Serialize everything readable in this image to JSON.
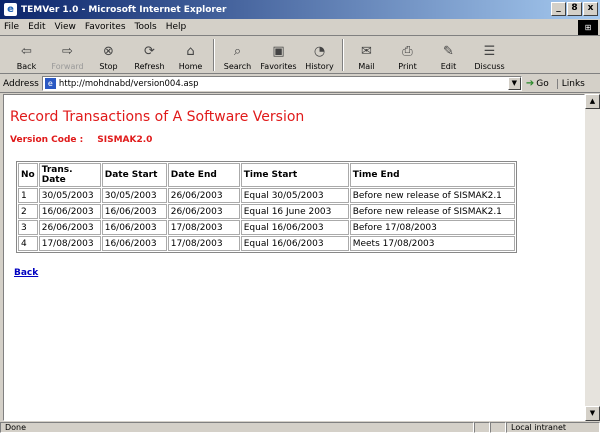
{
  "window": {
    "title": "TEMVer 1.0 - Microsoft Internet Explorer",
    "minimize": "_",
    "maximize": "8",
    "close": "x"
  },
  "menu": {
    "items": [
      "File",
      "Edit",
      "View",
      "Favorites",
      "Tools",
      "Help"
    ]
  },
  "toolbar": {
    "buttons": [
      {
        "label": "Back",
        "icon": "back-arrow-icon"
      },
      {
        "label": "Forward",
        "icon": "forward-arrow-icon"
      },
      {
        "label": "Stop",
        "icon": "stop-icon"
      },
      {
        "label": "Refresh",
        "icon": "refresh-icon"
      },
      {
        "label": "Home",
        "icon": "home-icon"
      },
      {
        "label": "Search",
        "icon": "search-icon"
      },
      {
        "label": "Favorites",
        "icon": "favorites-icon"
      },
      {
        "label": "History",
        "icon": "history-icon"
      },
      {
        "label": "Mail",
        "icon": "mail-icon"
      },
      {
        "label": "Print",
        "icon": "print-icon"
      },
      {
        "label": "Edit",
        "icon": "edit-icon"
      },
      {
        "label": "Discuss",
        "icon": "discuss-icon"
      }
    ]
  },
  "address": {
    "label": "Address",
    "url": "http://mohdnabd/version004.asp",
    "go": "Go",
    "links": "Links"
  },
  "page": {
    "title": "Record Transactions of A Software Version",
    "version_label": "Version Code :",
    "version_value": "SISMAK2.0",
    "table": {
      "headers": [
        "No",
        "Trans. Date",
        "Date Start",
        "Date End",
        "Time Start",
        "Time End"
      ],
      "rows": [
        [
          "1",
          "30/05/2003",
          "30/05/2003",
          "26/06/2003",
          "Equal  30/05/2003",
          "Before  new release of SISMAK2.1"
        ],
        [
          "2",
          "16/06/2003",
          "16/06/2003",
          "26/06/2003",
          "Equal  16 June 2003",
          "Before  new release of SISMAK2.1"
        ],
        [
          "3",
          "26/06/2003",
          "16/06/2003",
          "17/08/2003",
          "Equal  16/06/2003",
          "Before  17/08/2003"
        ],
        [
          "4",
          "17/08/2003",
          "16/06/2003",
          "17/08/2003",
          "Equal  16/06/2003",
          "Meets  17/08/2003"
        ]
      ]
    },
    "back_link": "Back"
  },
  "status": {
    "text": "Done",
    "zone": "Local intranet"
  },
  "colors": {
    "heading": "#e01a1a",
    "link": "#0000c0",
    "titlebar_start": "#0a246a"
  }
}
